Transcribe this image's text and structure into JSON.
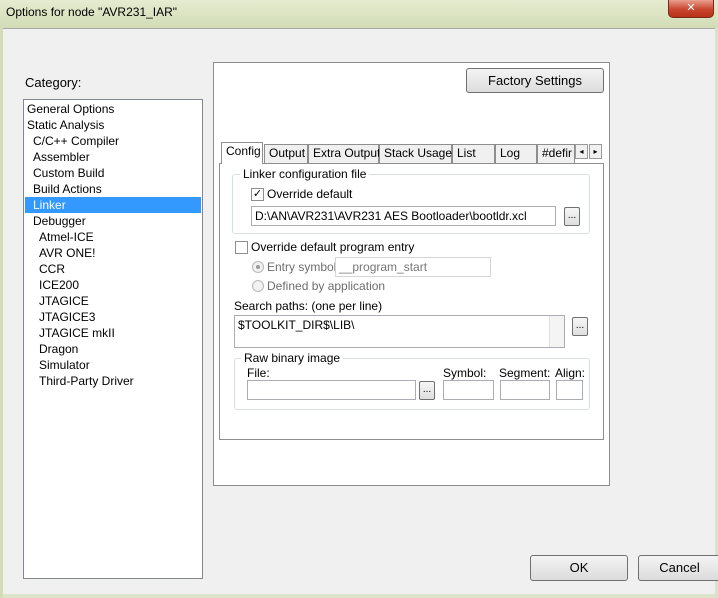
{
  "window": {
    "title": "Options for node \"AVR231_IAR\"",
    "close_glyph": "✕"
  },
  "category": {
    "label": "Category:",
    "items": [
      {
        "label": "General Options",
        "selected": false
      },
      {
        "label": "Static Analysis",
        "selected": false
      },
      {
        "label": "C/C++ Compiler",
        "selected": false
      },
      {
        "label": "Assembler",
        "selected": false
      },
      {
        "label": "Custom Build",
        "selected": false
      },
      {
        "label": "Build Actions",
        "selected": false
      },
      {
        "label": "Linker",
        "selected": true
      },
      {
        "label": "Debugger",
        "selected": false
      },
      {
        "label": "Atmel-ICE",
        "selected": false
      },
      {
        "label": "AVR ONE!",
        "selected": false
      },
      {
        "label": "CCR",
        "selected": false
      },
      {
        "label": "ICE200",
        "selected": false
      },
      {
        "label": "JTAGICE",
        "selected": false
      },
      {
        "label": "JTAGICE3",
        "selected": false
      },
      {
        "label": "JTAGICE mkII",
        "selected": false
      },
      {
        "label": "Dragon",
        "selected": false
      },
      {
        "label": "Simulator",
        "selected": false
      },
      {
        "label": "Third-Party Driver",
        "selected": false
      }
    ]
  },
  "factory_settings_label": "Factory Settings",
  "tabs": [
    {
      "label": "Config",
      "active": true
    },
    {
      "label": "Output",
      "active": false
    },
    {
      "label": "Extra Output",
      "active": false
    },
    {
      "label": "Stack Usage",
      "active": false
    },
    {
      "label": "List",
      "active": false
    },
    {
      "label": "Log",
      "active": false
    },
    {
      "label": "#defir",
      "active": false
    }
  ],
  "tab_scroll": {
    "left": "◂",
    "right": "▸"
  },
  "config": {
    "linker_config_group": "Linker configuration file",
    "override_default_label": "Override default",
    "override_default_checked": true,
    "config_file_path": "D:\\AN\\AVR231\\AVR231 AES Bootloader\\bootldr.xcl",
    "override_entry_label": "Override default program entry",
    "override_entry_checked": false,
    "entry_symbol_label": "Entry symbol",
    "entry_symbol_value": "__program_start",
    "defined_by_app_label": "Defined by application",
    "search_paths_label": "Search paths:  (one per line)",
    "search_paths_value": "$TOOLKIT_DIR$\\LIB\\",
    "raw_binary_group": "Raw binary image",
    "file_label": "File:",
    "symbol_label": "Symbol:",
    "segment_label": "Segment:",
    "align_label": "Align:",
    "browse_label": "..."
  },
  "buttons": {
    "ok": "OK",
    "cancel": "Cancel"
  }
}
